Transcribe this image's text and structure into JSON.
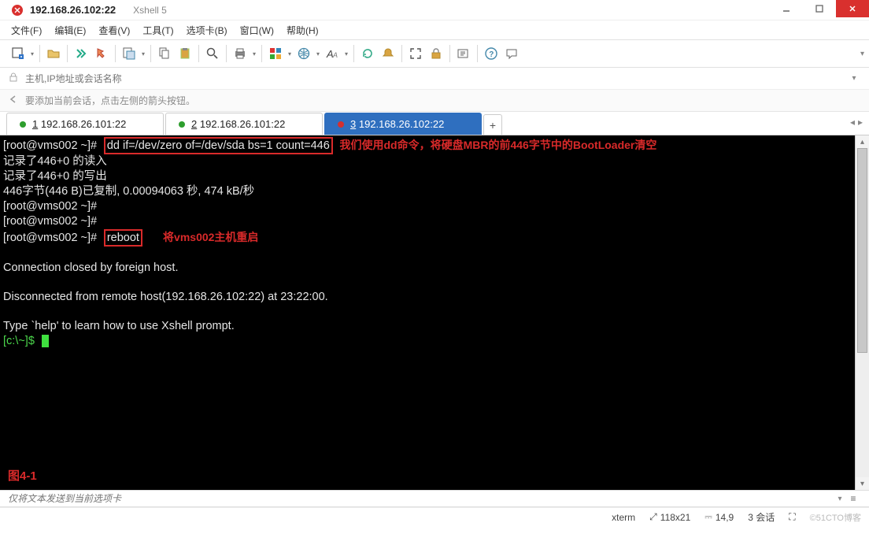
{
  "title": {
    "app_icon": "xshell-icon",
    "main": "192.168.26.102:22",
    "sub": "Xshell 5"
  },
  "menu": {
    "file": "文件(F)",
    "edit": "编辑(E)",
    "view": "查看(V)",
    "tools": "工具(T)",
    "tabs": "选项卡(B)",
    "window": "窗口(W)",
    "help": "帮助(H)"
  },
  "toolbar_icons": {
    "new_session": "new-session-icon",
    "open": "open-icon",
    "connect": "connect-icon",
    "disconnect": "disconnect-icon",
    "reconnect": "reconnect-icon",
    "properties": "properties-panel-icon",
    "copy": "copy-icon",
    "paste": "paste-icon",
    "find": "search-icon",
    "print": "print-icon",
    "colors": "color-scheme-icon",
    "globe": "language-icon",
    "font": "font-icon",
    "refresh": "refresh-icon",
    "bell": "notify-icon",
    "fullscreen": "fullscreen-icon",
    "lock": "lock-session-icon",
    "filebox": "compose-icon",
    "help": "help-icon",
    "chat": "chat-icon"
  },
  "addressbar": {
    "placeholder": "主机,IP地址或会话名称"
  },
  "hintbar": {
    "text": "要添加当前会话，点击左侧的箭头按钮。"
  },
  "tabs": [
    {
      "num": "1",
      "label": "192.168.26.101:22",
      "active": false
    },
    {
      "num": "2",
      "label": "192.168.26.101:22",
      "active": false
    },
    {
      "num": "3",
      "label": "192.168.26.102:22",
      "active": true
    }
  ],
  "terminal": {
    "prompt1": "[root@vms002 ~]#",
    "cmd_dd": "dd if=/dev/zero of=/dev/sda bs=1 count=446",
    "annotation1": "我们使用dd命令，将硬盘MBR的前446字节中的BootLoader清空",
    "line2": "记录了446+0 的读入",
    "line3": "记录了446+0 的写出",
    "line4": "446字节(446 B)已复制, 0.00094063 秒, 474 kB/秒",
    "prompt2": "[root@vms002 ~]#",
    "prompt3": "[root@vms002 ~]#",
    "prompt4": "[root@vms002 ~]#",
    "cmd_reboot": "reboot",
    "annotation2": "将vms002主机重启",
    "line_closed": "Connection closed by foreign host.",
    "line_disconnected": "Disconnected from remote host(192.168.26.102:22) at 23:22:00.",
    "line_help": "Type `help' to learn how to use Xshell prompt.",
    "local_prompt": "[c:\\~]$",
    "fig_label": "图4-1"
  },
  "bottom_input": {
    "placeholder": "仅将文本发送到当前选项卡"
  },
  "status": {
    "term": "xterm",
    "size": "118x21",
    "cursor": "14,9",
    "sessions_label": "3 会话",
    "watermark": "©51CTO博客"
  }
}
